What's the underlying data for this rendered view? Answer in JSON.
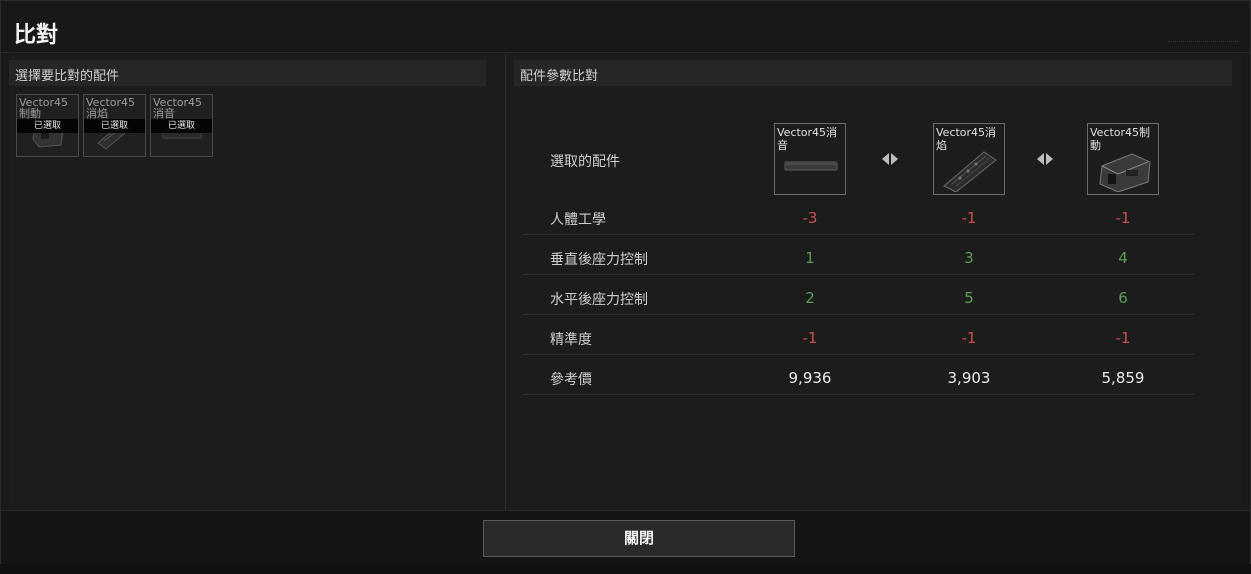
{
  "window": {
    "title": "比對"
  },
  "left_panel": {
    "header": "選擇要比對的配件",
    "slots": [
      {
        "name": "Vector45制動",
        "badge": "已選取",
        "icon": "compensator-icon"
      },
      {
        "name": "Vector45消焰",
        "badge": "已選取",
        "icon": "flash-hider-icon"
      },
      {
        "name": "Vector45消音",
        "badge": "已選取",
        "icon": "suppressor-icon"
      }
    ]
  },
  "right_panel": {
    "header": "配件參數比對",
    "selected_label": "選取的配件",
    "attachments": [
      {
        "name": "Vector45消音",
        "icon": "suppressor-icon"
      },
      {
        "name": "Vector45消焰",
        "icon": "flash-hider-icon"
      },
      {
        "name": "Vector45制動",
        "icon": "compensator-icon"
      }
    ],
    "rows": [
      {
        "label": "人體工學",
        "values": [
          "-3",
          "-1",
          "-1"
        ],
        "sentiment": [
          "neg",
          "neg",
          "neg"
        ]
      },
      {
        "label": "垂直後座力控制",
        "values": [
          "1",
          "3",
          "4"
        ],
        "sentiment": [
          "pos",
          "pos",
          "pos"
        ]
      },
      {
        "label": "水平後座力控制",
        "values": [
          "2",
          "5",
          "6"
        ],
        "sentiment": [
          "pos",
          "pos",
          "pos"
        ]
      },
      {
        "label": "精準度",
        "values": [
          "-1",
          "-1",
          "-1"
        ],
        "sentiment": [
          "neg",
          "neg",
          "neg"
        ]
      },
      {
        "label": "參考價",
        "values": [
          "9,936",
          "3,903",
          "5,859"
        ],
        "sentiment": [
          "price",
          "price",
          "price"
        ]
      }
    ]
  },
  "footer": {
    "close_label": "關閉"
  },
  "colors": {
    "negative": "#c84f4f",
    "positive": "#5a9e5a",
    "neutral": "#ececec"
  }
}
